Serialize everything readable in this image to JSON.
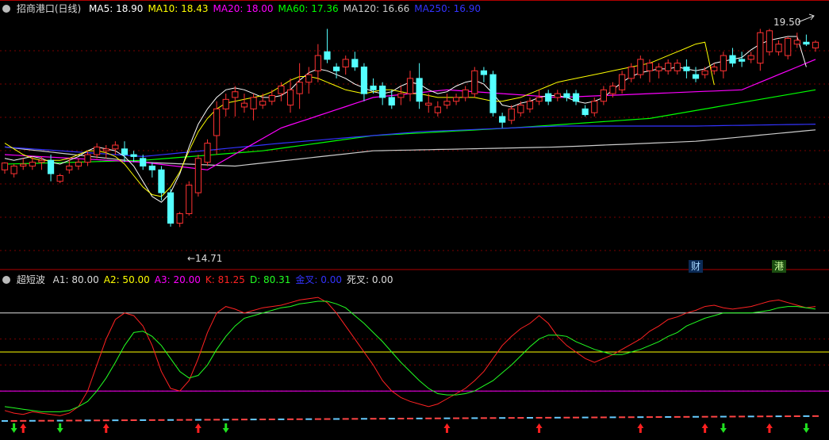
{
  "chart_data": [
    {
      "type": "candlestick",
      "title": "招商港口(日线)",
      "ylim": [
        14.0,
        20.2
      ],
      "series_legend": [
        {
          "label": "MA5",
          "value": "18.90",
          "color": "#ffffff"
        },
        {
          "label": "MA10",
          "value": "18.43",
          "color": "#ffff00"
        },
        {
          "label": "MA20",
          "value": "18.00",
          "color": "#ff00ff"
        },
        {
          "label": "MA60",
          "value": "17.36",
          "color": "#00ff00"
        },
        {
          "label": "MA120",
          "value": "16.66",
          "color": "#cccccc"
        },
        {
          "label": "MA250",
          "value": "16.90",
          "color": "#3333ff"
        }
      ],
      "ohlc": [
        [
          16.2,
          16.4,
          16.1,
          16.38
        ],
        [
          16.1,
          16.35,
          16.0,
          16.3
        ],
        [
          16.3,
          16.5,
          16.2,
          16.35
        ],
        [
          16.3,
          16.55,
          16.2,
          16.4
        ],
        [
          16.4,
          16.55,
          16.2,
          16.45
        ],
        [
          16.45,
          16.6,
          15.9,
          16.1
        ],
        [
          15.9,
          16.1,
          15.85,
          16.05
        ],
        [
          16.2,
          16.5,
          16.1,
          16.3
        ],
        [
          16.3,
          16.5,
          16.2,
          16.4
        ],
        [
          16.4,
          16.7,
          16.3,
          16.6
        ],
        [
          16.6,
          16.9,
          16.5,
          16.8
        ],
        [
          16.7,
          16.85,
          16.5,
          16.75
        ],
        [
          16.75,
          16.95,
          16.6,
          16.85
        ],
        [
          16.75,
          16.95,
          16.4,
          16.6
        ],
        [
          16.6,
          16.7,
          16.4,
          16.55
        ],
        [
          16.5,
          16.6,
          16.2,
          16.3
        ],
        [
          16.3,
          16.4,
          16.0,
          16.2
        ],
        [
          16.2,
          16.3,
          15.4,
          15.6
        ],
        [
          15.6,
          15.7,
          14.71,
          14.8
        ],
        [
          14.8,
          15.1,
          14.7,
          15.05
        ],
        [
          15.05,
          15.9,
          15.0,
          15.8
        ],
        [
          15.6,
          16.6,
          15.5,
          16.5
        ],
        [
          16.4,
          17.0,
          16.3,
          16.9
        ],
        [
          17.1,
          18.0,
          16.6,
          17.8
        ],
        [
          17.8,
          18.2,
          17.6,
          18.05
        ],
        [
          18.1,
          18.4,
          17.6,
          18.25
        ],
        [
          17.85,
          18.2,
          17.7,
          17.95
        ],
        [
          17.8,
          18.2,
          17.5,
          18.1
        ],
        [
          17.9,
          18.2,
          17.8,
          18.0
        ],
        [
          18.0,
          18.3,
          17.9,
          18.15
        ],
        [
          18.2,
          18.5,
          18.0,
          18.4
        ],
        [
          17.9,
          18.6,
          17.7,
          18.3
        ],
        [
          18.2,
          19.0,
          17.8,
          18.5
        ],
        [
          18.5,
          18.9,
          18.2,
          18.7
        ],
        [
          18.8,
          19.5,
          18.5,
          19.2
        ],
        [
          19.3,
          19.9,
          19.0,
          19.1
        ],
        [
          18.9,
          19.0,
          18.6,
          18.8
        ],
        [
          18.9,
          19.2,
          18.7,
          19.1
        ],
        [
          19.1,
          19.3,
          18.8,
          18.9
        ],
        [
          18.9,
          19.0,
          18.0,
          18.2
        ],
        [
          18.4,
          18.6,
          18.2,
          18.3
        ],
        [
          18.4,
          18.5,
          17.9,
          18.1
        ],
        [
          18.1,
          18.3,
          17.8,
          17.9
        ],
        [
          18.1,
          18.4,
          17.9,
          18.2
        ],
        [
          18.2,
          18.8,
          18.0,
          18.6
        ],
        [
          18.6,
          19.0,
          17.8,
          18.0
        ],
        [
          17.9,
          18.2,
          17.7,
          17.95
        ],
        [
          17.7,
          18.0,
          17.6,
          17.85
        ],
        [
          17.9,
          18.2,
          17.8,
          18.0
        ],
        [
          18.0,
          18.2,
          17.9,
          18.1
        ],
        [
          18.1,
          18.4,
          18.0,
          18.3
        ],
        [
          18.2,
          18.9,
          18.1,
          18.8
        ],
        [
          18.8,
          18.9,
          18.5,
          18.7
        ],
        [
          18.7,
          18.8,
          17.6,
          17.7
        ],
        [
          17.6,
          17.7,
          17.3,
          17.45
        ],
        [
          17.5,
          17.9,
          17.4,
          17.8
        ],
        [
          17.7,
          18.0,
          17.6,
          17.9
        ],
        [
          17.8,
          18.1,
          17.7,
          18.0
        ],
        [
          18.0,
          18.3,
          17.9,
          18.1
        ],
        [
          18.2,
          18.3,
          17.9,
          18.0
        ],
        [
          18.1,
          18.3,
          18.0,
          18.2
        ],
        [
          18.2,
          18.3,
          18.0,
          18.1
        ],
        [
          18.2,
          18.3,
          17.9,
          18.0
        ],
        [
          17.8,
          17.9,
          17.6,
          17.65
        ],
        [
          17.7,
          18.1,
          17.6,
          18.0
        ],
        [
          18.0,
          18.4,
          17.9,
          18.3
        ],
        [
          18.2,
          18.5,
          18.1,
          18.4
        ],
        [
          18.3,
          18.8,
          18.2,
          18.7
        ],
        [
          18.6,
          19.0,
          18.5,
          18.9
        ],
        [
          18.7,
          19.2,
          18.6,
          19.1
        ],
        [
          18.8,
          19.1,
          18.5,
          19.0
        ],
        [
          18.8,
          19.0,
          18.6,
          18.9
        ],
        [
          18.8,
          19.1,
          18.7,
          19.0
        ],
        [
          18.8,
          19.1,
          18.7,
          19.0
        ],
        [
          18.9,
          19.1,
          18.6,
          18.8
        ],
        [
          18.7,
          18.9,
          18.5,
          18.6
        ],
        [
          18.7,
          18.9,
          18.6,
          18.8
        ],
        [
          18.8,
          19.0,
          18.7,
          18.9
        ],
        [
          18.8,
          19.3,
          18.6,
          19.2
        ],
        [
          19.2,
          19.4,
          18.9,
          19.0
        ],
        [
          19.1,
          19.3,
          18.9,
          19.05
        ],
        [
          19.1,
          19.3,
          19.0,
          19.2
        ],
        [
          19.0,
          19.9,
          18.8,
          19.8
        ],
        [
          19.3,
          19.9,
          19.2,
          19.85
        ],
        [
          19.3,
          19.6,
          19.2,
          19.5
        ],
        [
          19.2,
          19.7,
          19.1,
          19.65
        ],
        [
          19.5,
          19.8,
          19.4,
          19.6
        ],
        [
          19.55,
          19.75,
          19.45,
          19.5
        ],
        [
          19.4,
          19.6,
          19.3,
          19.55
        ]
      ],
      "ma": [
        [
          16.5,
          16.45,
          16.5,
          16.55,
          16.5,
          16.4,
          16.35,
          16.45,
          16.55,
          16.7,
          16.8,
          16.75,
          16.7,
          16.55,
          16.3,
          15.9,
          15.5,
          15.35,
          15.6,
          16.1,
          16.8,
          17.4,
          17.8,
          18.1,
          18.3,
          18.35,
          18.3,
          18.2,
          18.1,
          18.1,
          18.15,
          18.3,
          18.55,
          18.75,
          18.85,
          18.8,
          18.7,
          18.6,
          18.45,
          18.35,
          18.25,
          18.2,
          18.25,
          18.4,
          18.5,
          18.45,
          18.3,
          18.2,
          18.25,
          18.4,
          18.5,
          18.55,
          18.45,
          18.2,
          17.9,
          17.85,
          17.95,
          18.0,
          18.1,
          18.15,
          18.15,
          18.1,
          18.0,
          17.95,
          18.0,
          18.1,
          18.3,
          18.5,
          18.65,
          18.75,
          18.8,
          18.85,
          18.85,
          18.9,
          18.85,
          18.8,
          18.85,
          19.0,
          19.05,
          19.1,
          19.15,
          19.35,
          19.5,
          19.6,
          19.65,
          19.7,
          19.7,
          18.9
        ],
        [
          16.9,
          16.75,
          16.6,
          16.5,
          16.45,
          16.45,
          16.45,
          16.5,
          16.6,
          16.7,
          16.7,
          16.65,
          16.55,
          16.35,
          16.05,
          15.75,
          15.55,
          15.5,
          15.75,
          16.15,
          16.7,
          17.2,
          17.55,
          17.8,
          17.95,
          18.0,
          18.05,
          18.1,
          18.15,
          18.25,
          18.4,
          18.55,
          18.65,
          18.65,
          18.6,
          18.5,
          18.4,
          18.3,
          18.25,
          18.2,
          18.25,
          18.3,
          18.3,
          18.25,
          18.2,
          18.2,
          18.15,
          18.1,
          18.1,
          18.1,
          18.1,
          18.1,
          18.05,
          18.0,
          18.0,
          18.05,
          18.1,
          18.2,
          18.3,
          18.4,
          18.5,
          18.55,
          18.6,
          18.65,
          18.7,
          18.75,
          18.8,
          18.85,
          18.9,
          18.95,
          19.0,
          19.1,
          19.2,
          19.3,
          19.4,
          19.5,
          19.55,
          18.43
        ]
      ]
    },
    {
      "type": "line",
      "title": "超短波",
      "ylim": [
        0,
        100
      ],
      "params": [
        {
          "label": "A1",
          "value": "80.00",
          "color": "#dddddd"
        },
        {
          "label": "A2",
          "value": "50.00",
          "color": "#ffff00"
        },
        {
          "label": "A3",
          "value": "20.00",
          "color": "#ff00ff"
        },
        {
          "label": "K",
          "value": "81.25",
          "color": "#ff2222"
        },
        {
          "label": "D",
          "value": "80.31",
          "color": "#22ff22"
        },
        {
          "label": "金叉",
          "value": "0.00",
          "color": "#3333ff"
        },
        {
          "label": "死叉",
          "value": "0.00",
          "color": "#dddddd"
        }
      ],
      "k": [
        5,
        3,
        2,
        4,
        3,
        2,
        1,
        3,
        8,
        20,
        40,
        60,
        75,
        80,
        78,
        70,
        55,
        35,
        22,
        20,
        28,
        45,
        65,
        80,
        85,
        83,
        80,
        82,
        84,
        85,
        86,
        88,
        90,
        91,
        92,
        88,
        80,
        70,
        60,
        50,
        40,
        28,
        20,
        15,
        12,
        10,
        8,
        10,
        14,
        18,
        22,
        28,
        35,
        45,
        55,
        62,
        68,
        72,
        78,
        72,
        62,
        55,
        50,
        45,
        42,
        45,
        48,
        52,
        56,
        60,
        66,
        70,
        75,
        77,
        80,
        82,
        85,
        86,
        84,
        83,
        84,
        85,
        87,
        89,
        90,
        88,
        86,
        84,
        85,
        81.25
      ],
      "d": [
        8,
        7,
        6,
        5,
        4,
        4,
        4,
        5,
        8,
        12,
        20,
        30,
        42,
        55,
        65,
        66,
        62,
        55,
        45,
        35,
        30,
        32,
        40,
        52,
        62,
        70,
        76,
        78,
        80,
        82,
        84,
        85,
        87,
        88,
        89,
        89,
        87,
        84,
        78,
        72,
        65,
        58,
        50,
        42,
        35,
        28,
        22,
        18,
        17,
        17,
        18,
        20,
        24,
        28,
        34,
        40,
        47,
        54,
        60,
        63,
        63,
        62,
        58,
        55,
        52,
        50,
        48,
        48,
        50,
        52,
        55,
        58,
        62,
        65,
        70,
        73,
        76,
        78,
        80,
        80,
        80,
        80,
        81,
        82,
        84,
        85,
        85,
        84,
        83,
        80.31
      ]
    }
  ],
  "price_labels": {
    "high": "19.50",
    "low": "14.71"
  },
  "event_tags": [
    {
      "text": "财",
      "color": "#a8d8ff",
      "bg": "#0b2a55"
    },
    {
      "text": "港",
      "color": "#cfff9f",
      "bg": "#1b4d10"
    }
  ],
  "signals": {
    "up_color": "#ff2020",
    "down_color": "#20e020",
    "up_idx": [
      2,
      11,
      21,
      48,
      58,
      69,
      76,
      83
    ],
    "down_idx": [
      1,
      6,
      24,
      78,
      87
    ]
  }
}
